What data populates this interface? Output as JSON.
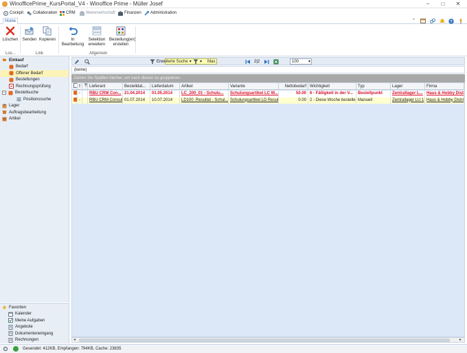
{
  "window": {
    "title": "WinofficePrime_KursPortal_V4 - Winoffice Prime - Müller Josef",
    "minimize": "–",
    "maximize": "□",
    "close": "✕"
  },
  "modules": [
    {
      "label": "Cockpit",
      "icon": "cockpit-icon",
      "color": "#6a7b8c"
    },
    {
      "label": "Collaboration",
      "icon": "collaboration-icon",
      "color": "#5a6a7a"
    },
    {
      "label": "CRM",
      "icon": "crm-icon",
      "color": "#2a6fc0"
    },
    {
      "label": "Warenwirtschaft",
      "icon": "warehouse-icon",
      "color": "#9aa4ae"
    },
    {
      "label": "Finanzen",
      "icon": "finance-icon",
      "color": "#4a5a6a"
    },
    {
      "label": "Administration",
      "icon": "administration-icon",
      "color": "#2a6fc0"
    }
  ],
  "tabs": {
    "home": "Home"
  },
  "ribbon": {
    "buttons": [
      {
        "label": "Löschen",
        "icon": "delete-icon"
      },
      {
        "label": "Senden",
        "icon": "send-icon"
      },
      {
        "label": "Kopieren",
        "icon": "copy-icon"
      },
      {
        "label": "In Bearbeitung",
        "icon": "undo-icon"
      },
      {
        "label": "Selektion erweitern",
        "icon": "extend-selection-icon"
      },
      {
        "label": "Bestellung(en) erstellen",
        "icon": "create-order-icon"
      }
    ],
    "groups": {
      "los": "Los...",
      "link": "Link",
      "allgemein": "Allgemein"
    }
  },
  "nav": {
    "items": [
      {
        "label": "Einkauf",
        "icon": "einkauf-icon"
      },
      {
        "label": "Bedarf",
        "icon": "bedarf-icon"
      },
      {
        "label": "Offener Bedarf",
        "icon": "offener-bedarf-icon"
      },
      {
        "label": "Bestellungen",
        "icon": "bestellungen-icon"
      },
      {
        "label": "Rechnungsprüfung",
        "icon": "rechnungspruefung-icon"
      },
      {
        "label": "Bestellsuche",
        "icon": "bestellsuche-icon"
      },
      {
        "label": "Positionssuche",
        "icon": "positionssuche-icon"
      },
      {
        "label": "Lager",
        "icon": "lager-icon"
      },
      {
        "label": "Auftragsbearbeitung",
        "icon": "auftragsbearbeitung-icon"
      },
      {
        "label": "Artikel",
        "icon": "artikel-icon"
      }
    ],
    "favorites": {
      "title": "Favoriten",
      "items": [
        "Kalender",
        "Meine Aufgaben",
        "Angebote",
        "Dokumenteneingang",
        "Rechnungen"
      ]
    }
  },
  "toolbar": {
    "advanced_search": "Erweiterte Suche",
    "max_label": "Max.",
    "max_value": "100",
    "page": "2|2"
  },
  "filter_text": "(keine)",
  "group_hint": "Ziehen Sie Spalten hierher, um nach diesen zu gruppieren.",
  "grid": {
    "columns": [
      "Lieferant",
      "Bestelldat...",
      "Lieferdatum",
      "Artikel",
      "Variante",
      "Nettobedarf",
      "Wichtigkeit",
      "Typ",
      "Lager",
      "Firma"
    ],
    "rows": [
      [
        "RBU CRM Con...",
        "21.04.2014",
        "01.05.2014",
        "LC_200_01 - Schulu...",
        "Schulungsartikel LC W...",
        "50.00",
        "6 - Fälligkeit in der V...",
        "Bestellpunkt",
        "Zentrallager L...",
        "Haus & Hobby Dist..."
      ],
      [
        "RBU CRM Consul...",
        "01.07.2014",
        "10.07.2014",
        "LD100_Resultat - Schul...",
        "Schulungsartikel LD Resul...",
        "0.00",
        "2 - Diese Woche bestellen",
        "Manuell",
        "Zentrallager LU 1",
        "Haus & Hobby Distrib..."
      ]
    ]
  },
  "status": {
    "text": "Gesendet: 412KB, Empfangen: 794KB, Cache: 23835"
  }
}
